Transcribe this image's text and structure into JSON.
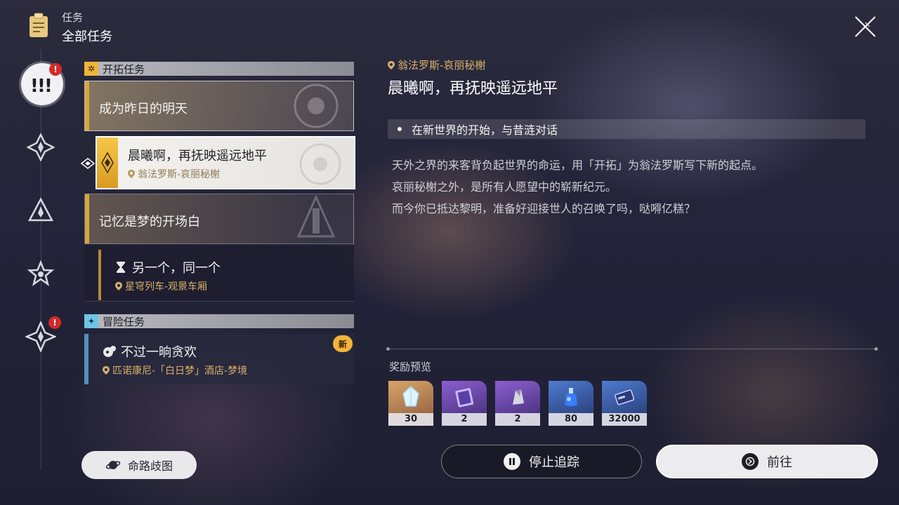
{
  "header": {
    "section_label": "任务",
    "title": "全部任务",
    "icon": "clipboard-icon"
  },
  "rail": {
    "items": [
      {
        "icon": "mission-all-icon",
        "active": true,
        "alert": "!"
      },
      {
        "icon": "trailblaze-star-icon"
      },
      {
        "icon": "triangle-star-icon"
      },
      {
        "icon": "star-outline-icon"
      },
      {
        "icon": "adventure-star-icon",
        "alert": "!"
      }
    ]
  },
  "sections": {
    "trailblaze": {
      "label": "开拓任务",
      "accent": "#d7a83a"
    },
    "adventure": {
      "label": "冒险任务",
      "accent": "#4f93b8"
    }
  },
  "quests": {
    "q1": {
      "title": "成为昨日的明天"
    },
    "q2": {
      "title": "晨曦啊，再抚映遥远地平",
      "location": "翁法罗斯-哀丽秘榭"
    },
    "q3": {
      "title": "记忆是梦的开场白"
    },
    "q4": {
      "title": "另一个，同一个",
      "location": "星穹列车-观景车厢"
    },
    "q5": {
      "title": "不过一晌贪欢",
      "location": "匹诺康尼-「白日梦」酒店-梦境",
      "badge": "新"
    }
  },
  "detail": {
    "location": "翁法罗斯-哀丽秘榭",
    "title": "晨曦啊，再抚映遥远地平",
    "objective": "在新世界的开始，与昔涟对话",
    "description": [
      "天外之界的来客背负起世界的命运，用「开拓」为翁法罗斯写下新的起点。",
      "哀丽秘榭之外，是所有人愿望中的崭新纪元。",
      "而今你已抵达黎明，准备好迎接世人的召唤了吗，哒嘚亿糕？"
    ]
  },
  "rewards": {
    "label": "奖励预览",
    "items": [
      {
        "icon": "stellar-jade-icon",
        "count": "30"
      },
      {
        "icon": "purple-book-icon",
        "count": "2"
      },
      {
        "icon": "purple-material-icon",
        "count": "2"
      },
      {
        "icon": "blue-potion-icon",
        "count": "80"
      },
      {
        "icon": "credit-card-icon",
        "count": "32000"
      }
    ]
  },
  "buttons": {
    "path_tree": "命路歧图",
    "stop_tracking": "停止追踪",
    "go": "前往"
  }
}
